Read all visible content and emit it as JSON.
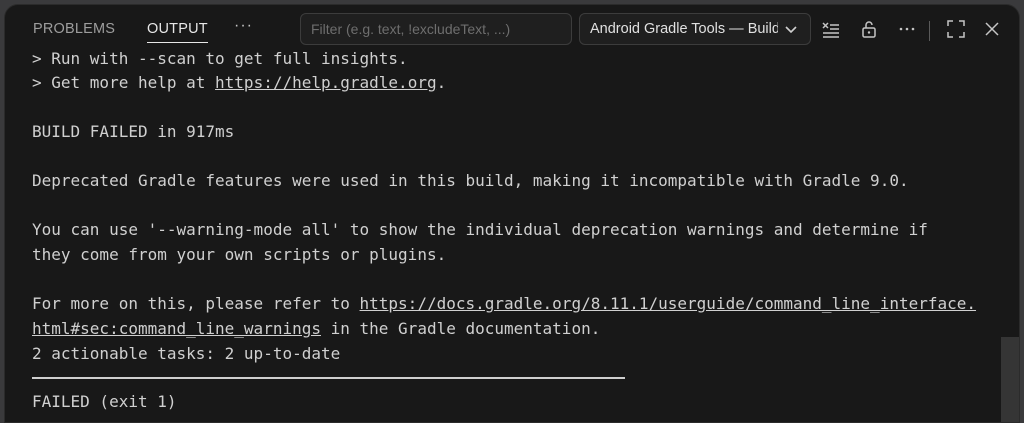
{
  "tabs": {
    "problems": "PROBLEMS",
    "output": "OUTPUT",
    "more": "···"
  },
  "filter": {
    "placeholder": "Filter (e.g. text, !excludeText, ...)",
    "value": ""
  },
  "channel_select": {
    "selected": "Android Gradle Tools — Build"
  },
  "toolbar_icons": [
    "clear-output-icon",
    "lock-scroll-icon",
    "more-actions-icon",
    "maximize-icon",
    "close-icon"
  ],
  "output": {
    "line1": "> Run with --scan to get full insights.",
    "line2_prefix": "> Get more help at ",
    "line2_link": "https://help.gradle.org",
    "line2_suffix": ".",
    "line3": "BUILD FAILED in 917ms",
    "line4": "Deprecated Gradle features were used in this build, making it incompatible with Gradle 9.0.",
    "line5a": "You can use '--warning-mode all' to show the individual deprecation warnings and determine if",
    "line5b": "they come from your own scripts or plugins.",
    "line6_prefix": "For more on this, please refer to ",
    "line6_link": "https://docs.gradle.org/8.11.1/userguide/command_line_interface.",
    "line7_link": "html#sec:command_line_warnings",
    "line7_suffix": " in the Gradle documentation.",
    "line8": "2 actionable tasks: 2 up-to-date",
    "line9": "FAILED (exit 1)"
  },
  "colors": {
    "background": "#181818",
    "text": "#d0d0d0",
    "active_tab": "#e7e7e7",
    "inactive_tab": "#9d9d9d"
  }
}
